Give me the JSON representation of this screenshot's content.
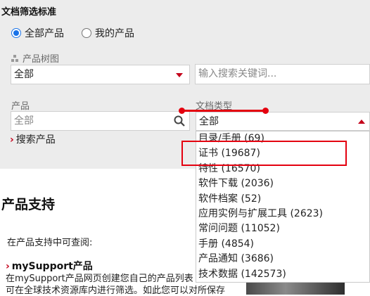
{
  "filter": {
    "title": "文档筛选标准",
    "radio_all": "全部产品",
    "radio_mine": "我的产品",
    "tree_label": "产品树图",
    "tree_select": "全部",
    "keyword_placeholder": "输入搜索关键词...",
    "product_label": "产品",
    "product_placeholder": "全部",
    "doctype_label": "文档类型",
    "doctype_value": "全部",
    "search_products": "搜索产品"
  },
  "dropdown": {
    "options": [
      "目录/手册 (69)",
      "证书 (19687)",
      "特性 (16570)",
      "软件下载 (2036)",
      "软件档案 (52)",
      "应用实例与扩展工具 (2623)",
      "常问问题 (11052)",
      "手册 (4854)",
      "产品通知 (3686)",
      "技术数据 (142573)"
    ],
    "highlighted": "证书 (19687)"
  },
  "support": {
    "title": "产品支持",
    "intro": "在产品支持中可查阅:",
    "mysupport_title": "mySupport产品",
    "para_line1": "在mySupport产品网页创建您自己的产品列表",
    "para_line2": "可在全球技术资源库内进行筛选。如此您可以对所保存"
  },
  "colors": {
    "accent_red": "#c4001a",
    "annotation_red": "#e4000f",
    "radio_blue": "#1a73e8",
    "panel_bg": "#ececec"
  },
  "icons": [
    "tree-icon",
    "search-icon",
    "chevron-right-icon",
    "caret-down-icon",
    "caret-up-icon"
  ]
}
